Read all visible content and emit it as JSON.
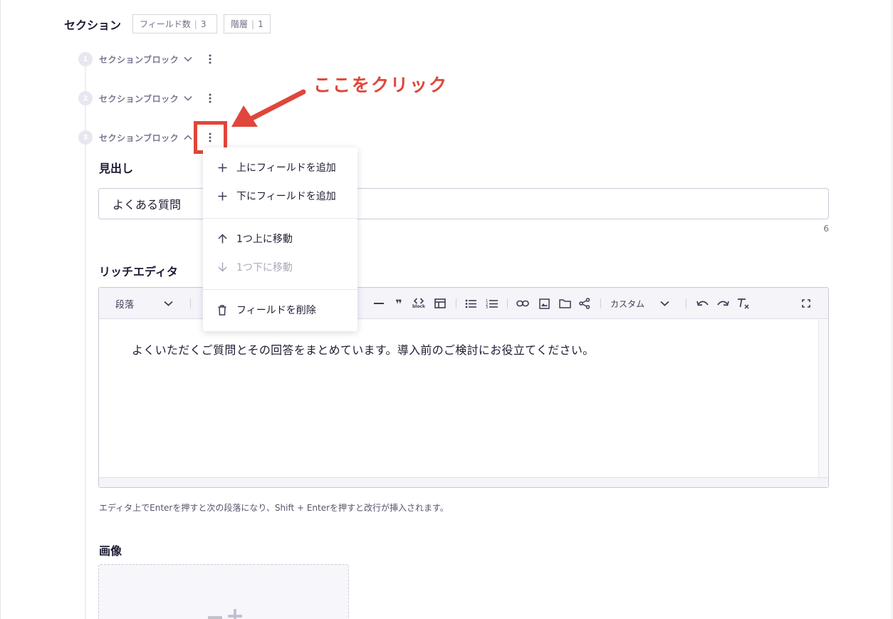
{
  "section": {
    "title": "セクション",
    "field_count_label": "フィールド数",
    "field_count": "3",
    "depth_label": "階層",
    "depth": "1"
  },
  "blocks": [
    {
      "number": "1",
      "label": "セクションブロック"
    },
    {
      "number": "2",
      "label": "セクションブロック"
    },
    {
      "number": "3",
      "label": "セクションブロック"
    }
  ],
  "annotation": {
    "text": "ここをクリック",
    "color": "#e0463b"
  },
  "heading_field": {
    "label": "見出し",
    "value": "よくある質問",
    "char_count": "6"
  },
  "rich_editor": {
    "label": "リッチエディタ",
    "paragraph_select": "段落",
    "custom_select": "カスタム",
    "block_code_caption": "block",
    "content": "よくいただくご質問とその回答をまとめています。導入前のご検討にお役立てください。",
    "help_text": "エディタ上でEnterを押すと次の段落になり、Shift + Enterを押すと改行が挿入されます。"
  },
  "image_field": {
    "label": "画像"
  },
  "context_menu": {
    "items": [
      {
        "icon": "plus-icon",
        "label": "上にフィールドを追加",
        "disabled": false
      },
      {
        "icon": "plus-icon",
        "label": "下にフィールドを追加",
        "disabled": false
      },
      {
        "icon": "arrow-up-icon",
        "label": "1つ上に移動",
        "disabled": false
      },
      {
        "icon": "arrow-down-icon",
        "label": "1つ下に移動",
        "disabled": true
      },
      {
        "icon": "trash-icon",
        "label": "フィールドを削除",
        "disabled": false
      }
    ]
  },
  "colors": {
    "accent": "#e0463b",
    "text": "#1d1d33",
    "muted": "#777790",
    "step_bg": "#e7e7f1",
    "toolbar_bg": "#f4f4f9"
  }
}
